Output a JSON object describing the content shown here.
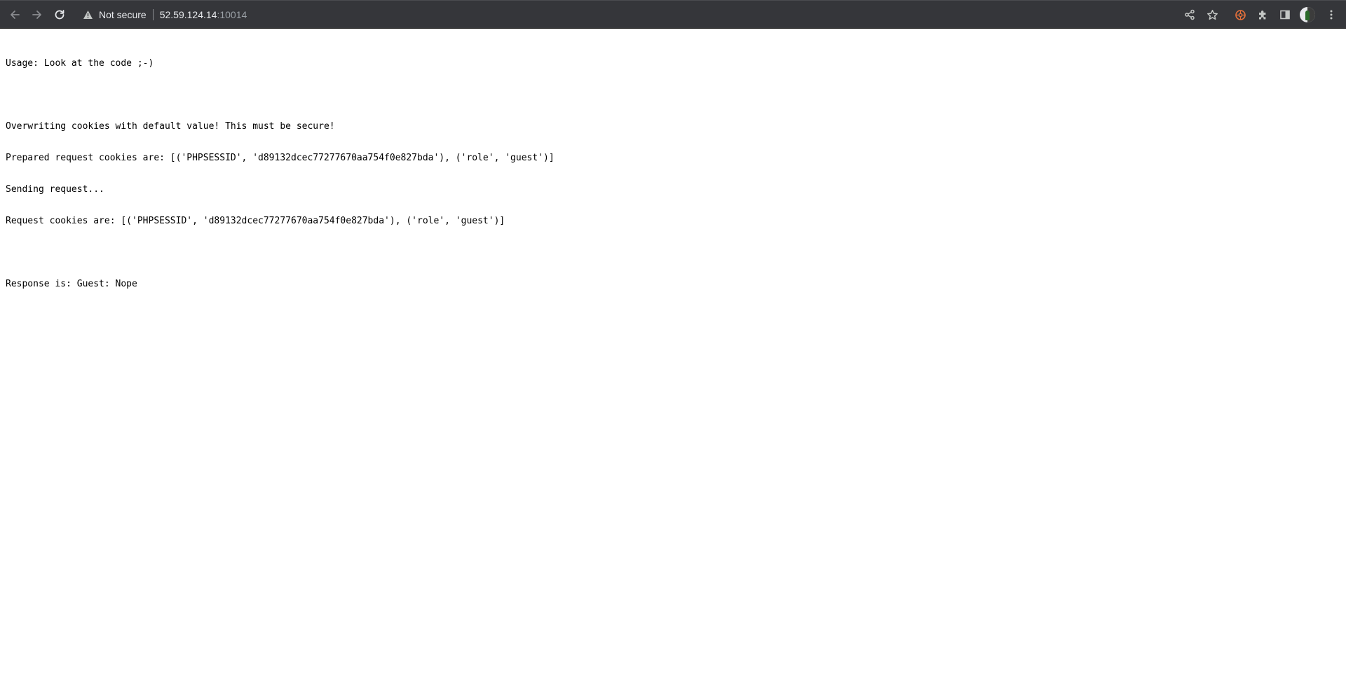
{
  "browser": {
    "security_label": "Not secure",
    "url_host": "52.59.124.14",
    "url_port": ":10014",
    "colors": {
      "toolbar_bg": "#35363a",
      "icon": "#c4c7c5",
      "text": "#e8eaed",
      "port_text": "#9aa0a6",
      "extension_accent": "#e8713a"
    },
    "icons": {
      "back": "arrow-left-icon",
      "forward": "arrow-right-icon",
      "reload": "reload-icon",
      "security": "warning-triangle-icon",
      "share": "share-icon",
      "bookmark": "star-icon",
      "extension_1": "cookie-extension-icon",
      "extensions": "puzzle-icon",
      "side_panel": "side-panel-icon",
      "profile": "avatar-icon",
      "menu": "kebab-menu-icon"
    }
  },
  "page": {
    "lines": [
      "Usage: Look at the code ;-)",
      "",
      "Overwriting cookies with default value! This must be secure!",
      "Prepared request cookies are: [('PHPSESSID', 'd89132dcec77277670aa754f0e827bda'), ('role', 'guest')]",
      "Sending request...",
      "Request cookies are: [('PHPSESSID', 'd89132dcec77277670aa754f0e827bda'), ('role', 'guest')]",
      "",
      "Response is: Guest: Nope"
    ]
  }
}
